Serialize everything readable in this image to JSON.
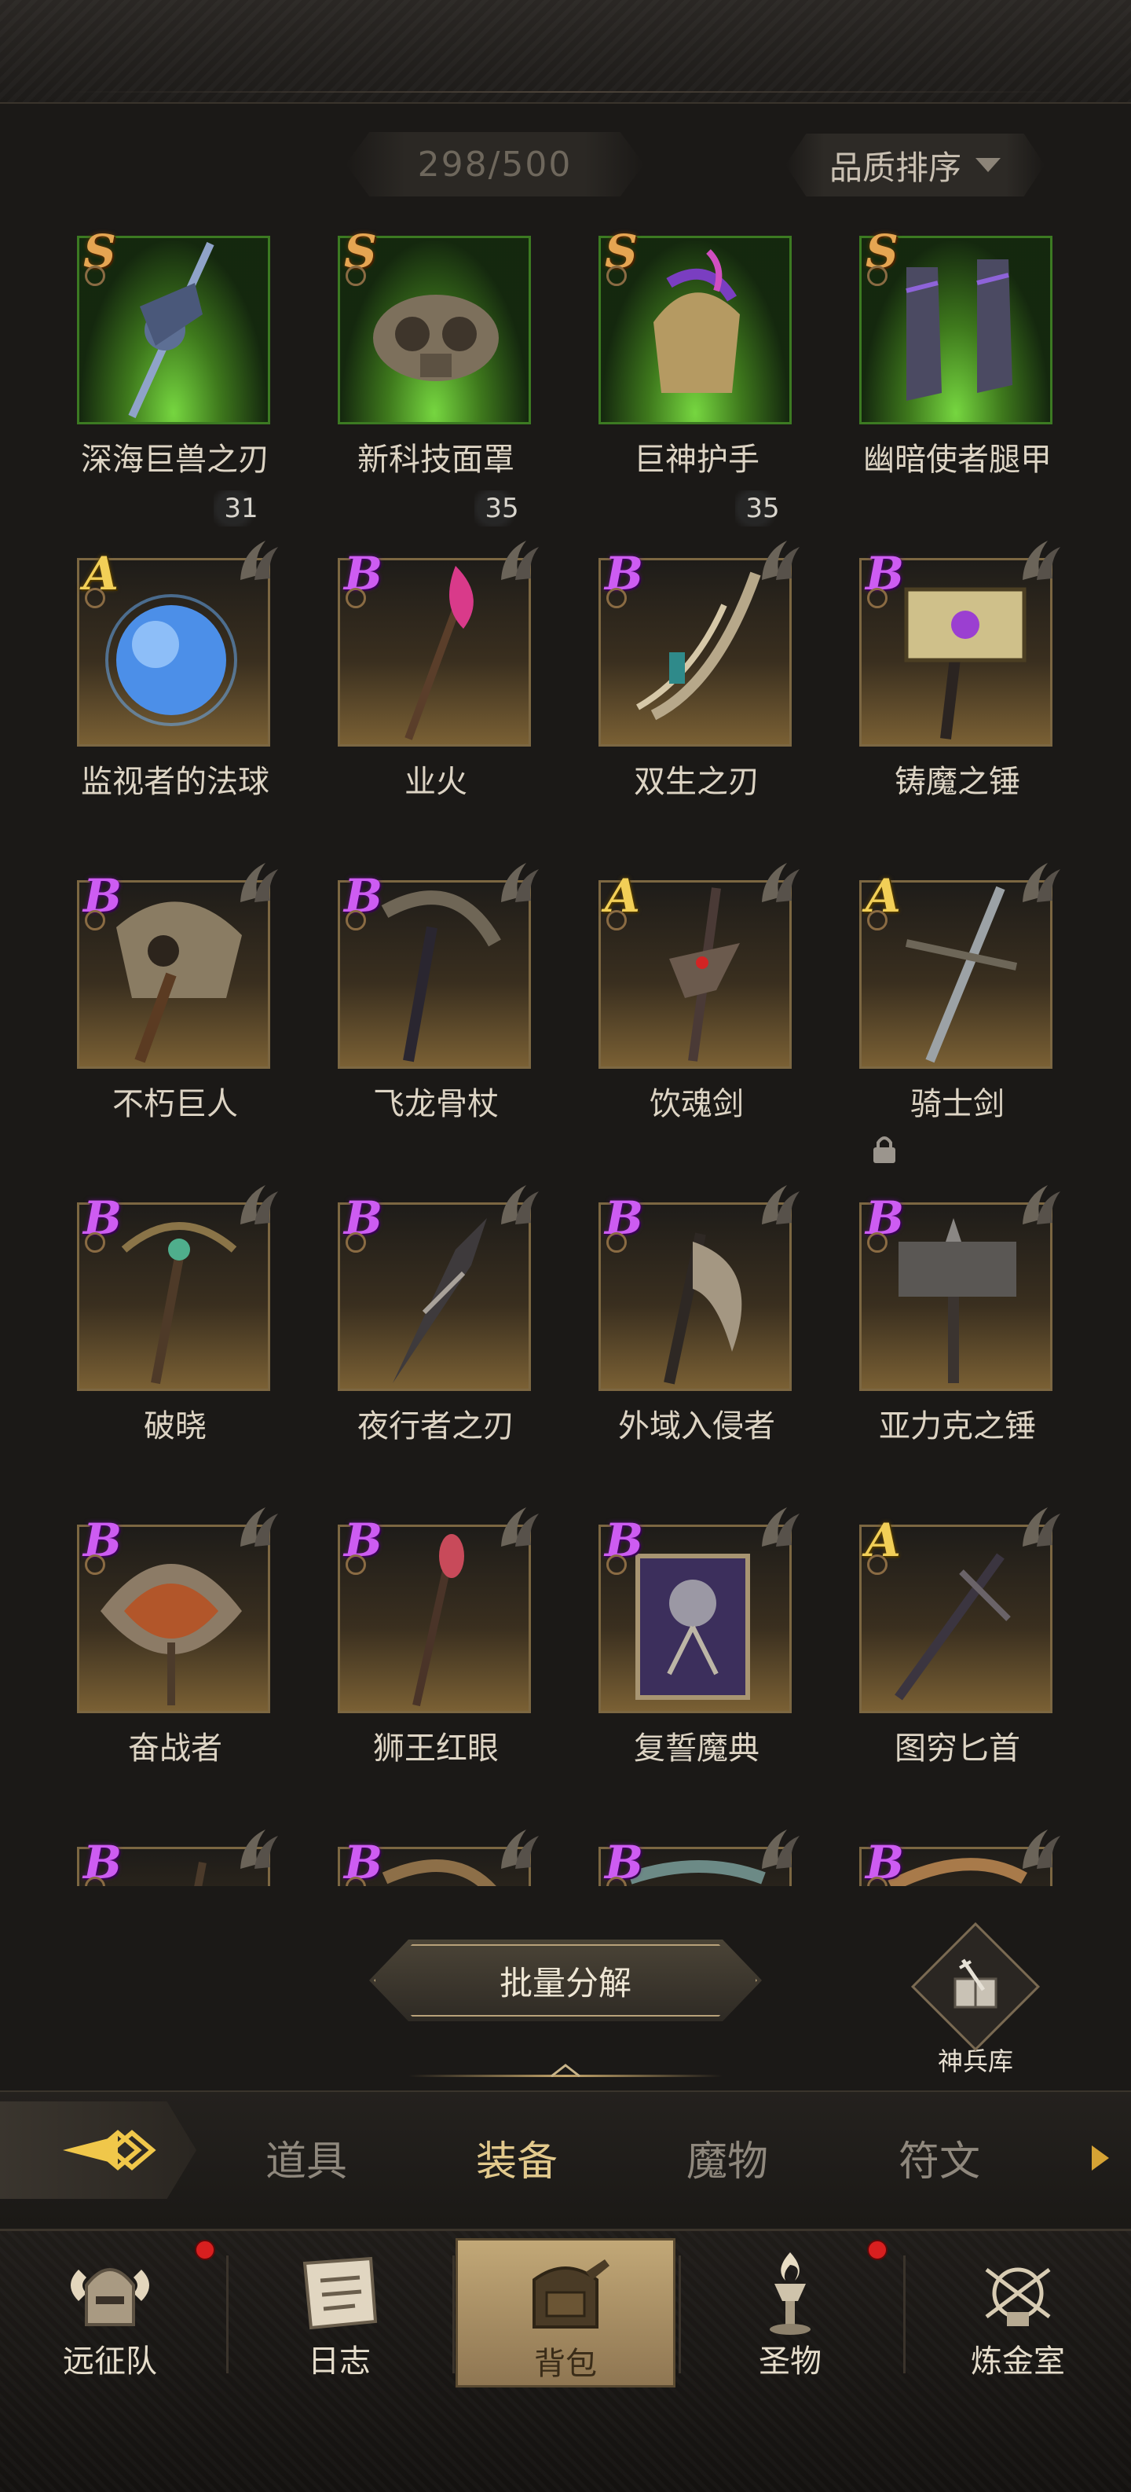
{
  "inventory": {
    "count": "298/500"
  },
  "sort": {
    "label": "品质排序",
    "icon": "chevron-down-icon"
  },
  "items": [
    {
      "grade": "S",
      "name": "深海巨兽之刃",
      "level": "31",
      "tier": "s"
    },
    {
      "grade": "S",
      "name": "新科技面罩",
      "level": "35",
      "tier": "s"
    },
    {
      "grade": "S",
      "name": "巨神护手",
      "level": "35",
      "tier": "s"
    },
    {
      "grade": "S",
      "name": "幽暗使者腿甲",
      "level": "",
      "tier": "s"
    },
    {
      "grade": "A",
      "name": "监视者的法球",
      "level": "",
      "tier": "a"
    },
    {
      "grade": "B",
      "name": "业火",
      "level": "",
      "tier": "b"
    },
    {
      "grade": "B",
      "name": "双生之刃",
      "level": "",
      "tier": "b"
    },
    {
      "grade": "B",
      "name": "铸魔之锤",
      "level": "",
      "tier": "b"
    },
    {
      "grade": "B",
      "name": "不朽巨人",
      "level": "",
      "tier": "b"
    },
    {
      "grade": "B",
      "name": "飞龙骨杖",
      "level": "",
      "tier": "b"
    },
    {
      "grade": "A",
      "name": "饮魂剑",
      "level": "",
      "tier": "a"
    },
    {
      "grade": "A",
      "name": "骑士剑",
      "level": "",
      "tier": "a",
      "locked": true
    },
    {
      "grade": "B",
      "name": "破晓",
      "level": "",
      "tier": "b"
    },
    {
      "grade": "B",
      "name": "夜行者之刃",
      "level": "",
      "tier": "b"
    },
    {
      "grade": "B",
      "name": "外域入侵者",
      "level": "",
      "tier": "b"
    },
    {
      "grade": "B",
      "name": "亚力克之锤",
      "level": "",
      "tier": "b"
    },
    {
      "grade": "B",
      "name": "奋战者",
      "level": "",
      "tier": "b"
    },
    {
      "grade": "B",
      "name": "狮王红眼",
      "level": "",
      "tier": "b"
    },
    {
      "grade": "B",
      "name": "复誓魔典",
      "level": "",
      "tier": "b"
    },
    {
      "grade": "A",
      "name": "图穷匕首",
      "level": "",
      "tier": "a"
    },
    {
      "grade": "B",
      "name": "",
      "level": "",
      "tier": "b"
    },
    {
      "grade": "B",
      "name": "",
      "level": "",
      "tier": "b"
    },
    {
      "grade": "B",
      "name": "",
      "level": "",
      "tier": "b"
    },
    {
      "grade": "B",
      "name": "",
      "level": "",
      "tier": "b"
    }
  ],
  "actions": {
    "batch_dismantle": "批量分解",
    "armory": "神兵库"
  },
  "category_tabs": [
    {
      "label": "道具",
      "active": false
    },
    {
      "label": "装备",
      "active": true
    },
    {
      "label": "魔物",
      "active": false
    },
    {
      "label": "符文",
      "active": false
    }
  ],
  "bottom_nav": [
    {
      "label": "远征队",
      "icon": "horned-helmet-icon",
      "badge": true,
      "active": false
    },
    {
      "label": "日志",
      "icon": "scroll-icon",
      "badge": false,
      "active": false
    },
    {
      "label": "背包",
      "icon": "backpack-icon",
      "badge": false,
      "active": true
    },
    {
      "label": "圣物",
      "icon": "torch-icon",
      "badge": true,
      "active": false
    },
    {
      "label": "炼金室",
      "icon": "alchemy-icon",
      "badge": false,
      "active": false
    }
  ],
  "colors": {
    "grade_S": "#e5a552",
    "grade_A": "#f2cf57",
    "grade_B": "#cd5cf2",
    "active_tab": "#e2c98c",
    "badge_red": "#d81f1f",
    "gold_accent": "#d6a334"
  }
}
